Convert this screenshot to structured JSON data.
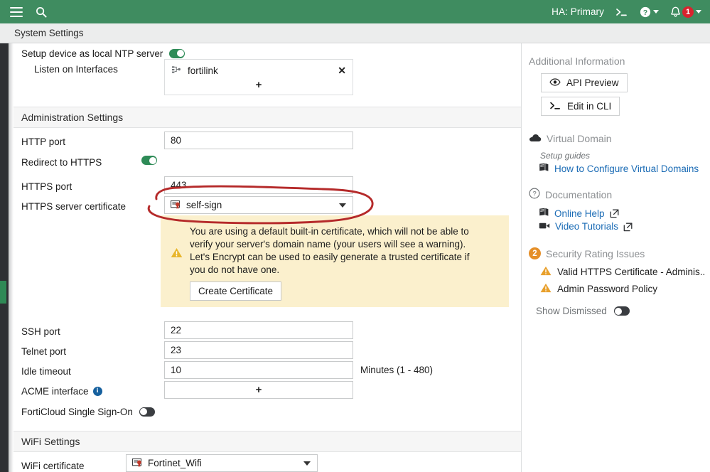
{
  "topbar": {
    "menu_icon": "hamburger-icon",
    "search_icon": "search-icon",
    "ha_status": "HA:  Primary",
    "cli_icon": "cli-console-icon",
    "help_icon": "help-circle-icon",
    "alert_icon": "bell-icon",
    "alert_count": "1"
  },
  "titlebar": {
    "breadcrumb": "System Settings"
  },
  "main": {
    "ntp": {
      "label": "Setup device as local NTP server",
      "toggle_state": "on",
      "listen_label": "Listen on Interfaces",
      "interfaces": [
        {
          "name": "fortilink",
          "icon": "interface-icon",
          "remove_icon": "close-icon"
        }
      ],
      "add_label": "+"
    },
    "admin_section": {
      "title": "Administration Settings",
      "http_port_label": "HTTP port",
      "http_port_value": "80",
      "redirect_label": "Redirect to HTTPS",
      "redirect_state": "on",
      "https_port_label": "HTTPS port",
      "https_port_value": "443",
      "cert_label": "HTTPS server certificate",
      "cert_value": "self-sign",
      "warning": {
        "line1": "You are using a default built-in certificate, which will not be able to",
        "line2": "verify your server's domain name (your users will see a warning).",
        "line3": "Let's Encrypt can be used to easily generate a trusted certificate if",
        "line4": "you do not have one.",
        "button": "Create Certificate",
        "icon": "warning-triangle-icon"
      },
      "ssh_port_label": "SSH port",
      "ssh_port_value": "22",
      "telnet_port_label": "Telnet port",
      "telnet_port_value": "23",
      "idle_timeout_label": "Idle timeout",
      "idle_timeout_value": "10",
      "idle_timeout_suffix": "Minutes (1 - 480)",
      "acme_label": "ACME interface",
      "acme_info_icon": "info-icon",
      "acme_add": "+",
      "fsso_label": "FortiCloud Single Sign-On",
      "fsso_state": "off"
    },
    "wifi_section": {
      "title": "WiFi Settings",
      "cert_label": "WiFi certificate",
      "cert_value": "Fortinet_Wifi"
    }
  },
  "sidebar": {
    "additional_info_title": "Additional Information",
    "api_preview": {
      "label": "API Preview",
      "icon": "eye-icon"
    },
    "edit_in_cli": {
      "label": "Edit in CLI",
      "icon": "cli-console-icon"
    },
    "virtual_domain": {
      "title": "Virtual Domain",
      "icon": "cloud-icon"
    },
    "setup_guides_label": "Setup guides",
    "vdom_guide": {
      "label": "How to Configure Virtual Domains",
      "icon": "book-icon"
    },
    "documentation": {
      "title": "Documentation",
      "icon": "question-circle-icon"
    },
    "online_help": {
      "label": "Online Help",
      "icon": "book-icon",
      "ext_icon": "external-link-icon"
    },
    "video_tutorials": {
      "label": "Video Tutorials",
      "icon": "video-camera-icon",
      "ext_icon": "external-link-icon"
    },
    "security_rating": {
      "title": "Security Rating Issues",
      "count": "2"
    },
    "issues": [
      {
        "label": "Valid HTTPS Certificate - Adminis...",
        "icon": "warning-triangle-icon"
      },
      {
        "label": "Admin Password Policy",
        "icon": "warning-triangle-icon"
      }
    ],
    "show_dismissed": {
      "label": "Show Dismissed",
      "state": "off"
    }
  },
  "colors": {
    "brand_green": "#3f8c60",
    "toggle_on": "#2e8b57",
    "warning_bg": "#fbf0cd",
    "warning_amber": "#e8b62c",
    "link_blue": "#1a6bb5",
    "badge_red": "#d9232e",
    "rating_orange": "#e58f28",
    "annotation_red": "#b52a2a"
  },
  "annotation": {
    "shape": "hand-drawn-ellipse",
    "target": "HTTPS server certificate dropdown"
  }
}
